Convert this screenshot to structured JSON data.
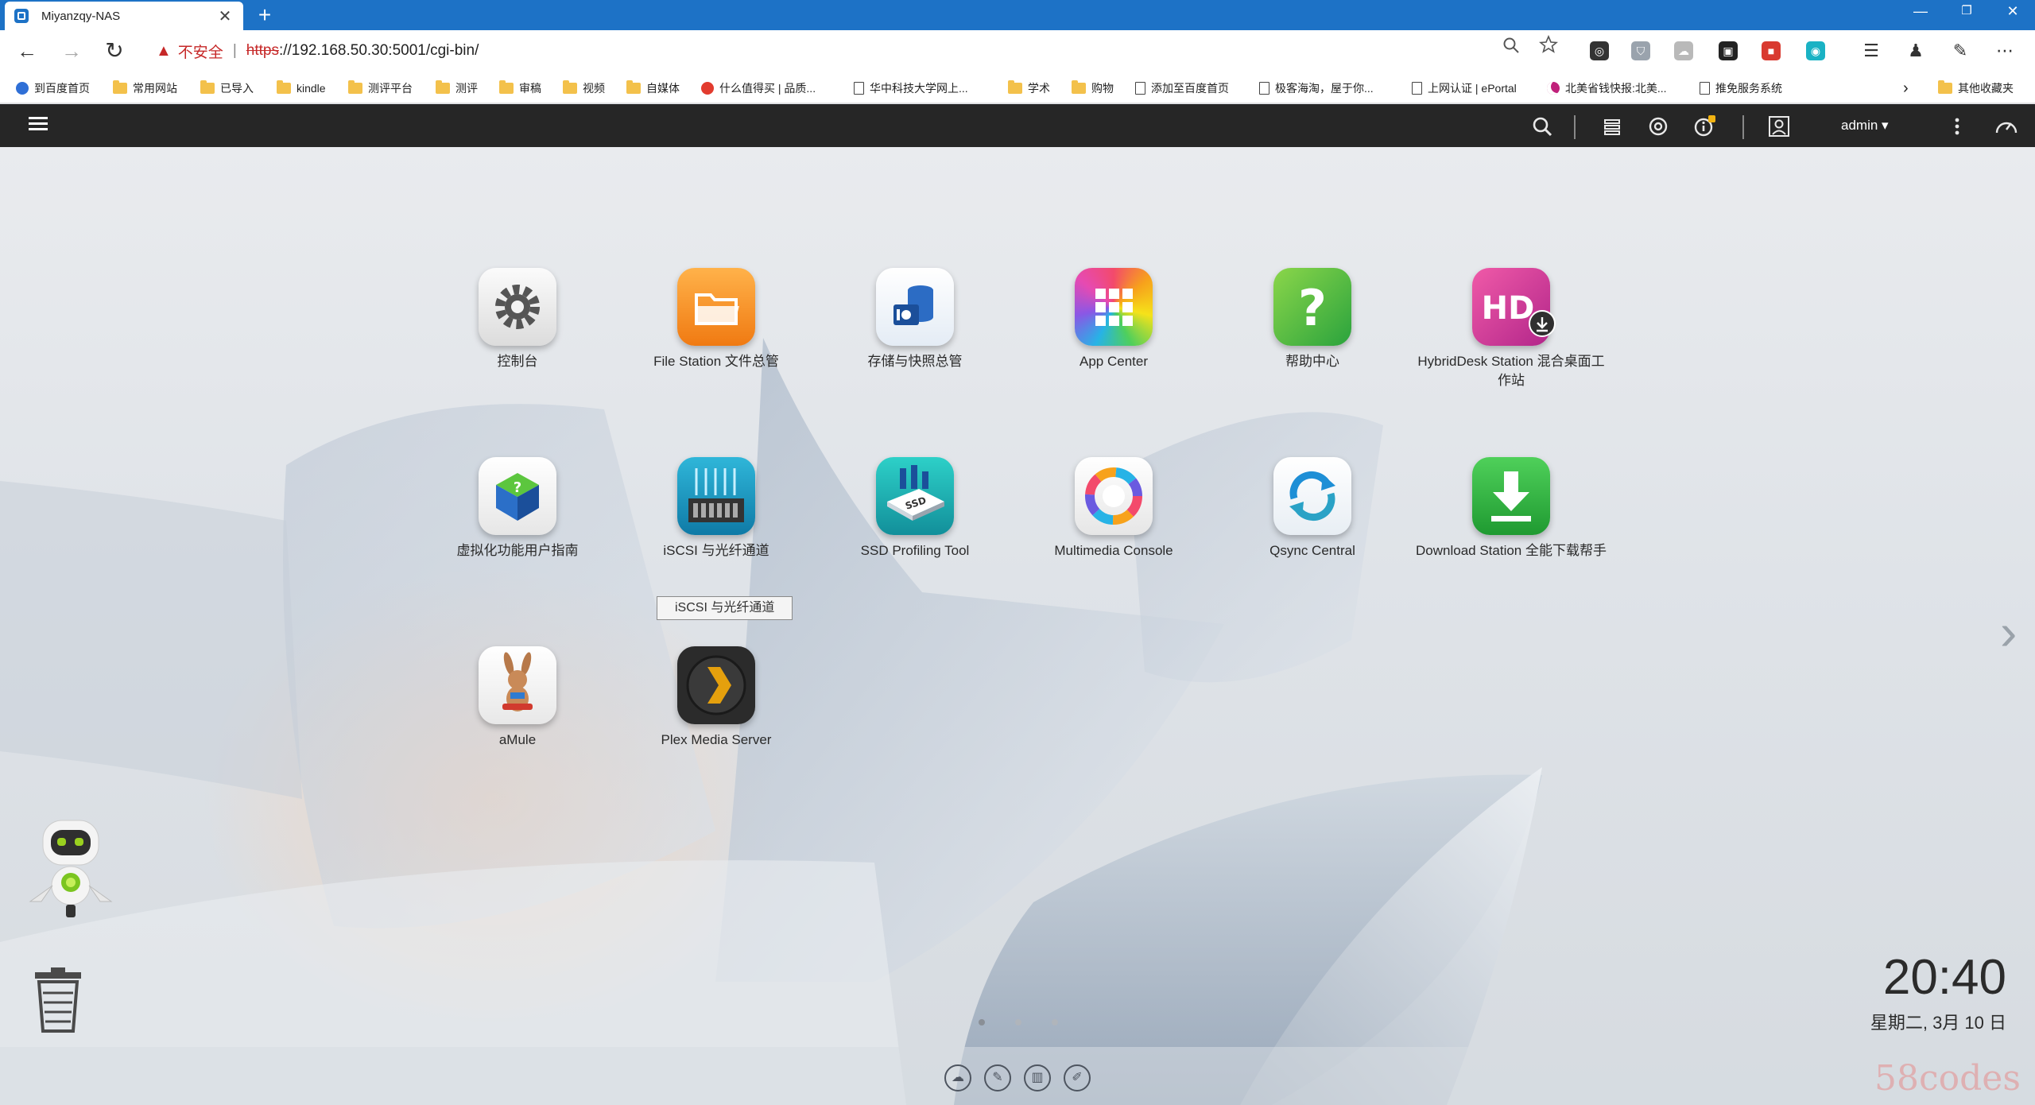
{
  "browser": {
    "tab_title": "Miyanzqy-NAS",
    "tab_close": "✕",
    "new_tab": "+",
    "window": {
      "minimize": "—",
      "maximize": "❐",
      "close": "✕"
    },
    "nav": {
      "back": "←",
      "forward": "→",
      "reload": "↻"
    },
    "address": {
      "security_icon": "▲",
      "security_text": "不安全",
      "separator": "|",
      "url_scheme": "https",
      "url_rest": "://192.168.50.30:5001/cgi-bin/"
    },
    "bookmarks": [
      {
        "label": "到百度首页",
        "icon": "paw"
      },
      {
        "label": "常用网站",
        "icon": "folder"
      },
      {
        "label": "已导入",
        "icon": "folder"
      },
      {
        "label": "kindle",
        "icon": "folder"
      },
      {
        "label": "测评平台",
        "icon": "folder"
      },
      {
        "label": "测评",
        "icon": "folder"
      },
      {
        "label": "审稿",
        "icon": "folder"
      },
      {
        "label": "视频",
        "icon": "folder"
      },
      {
        "label": "自媒体",
        "icon": "folder"
      },
      {
        "label": "什么值得买 | 品质...",
        "icon": "smzdm"
      },
      {
        "label": "华中科技大学网上...",
        "icon": "page"
      },
      {
        "label": "学术",
        "icon": "folder"
      },
      {
        "label": "购物",
        "icon": "folder"
      },
      {
        "label": "添加至百度首页",
        "icon": "page"
      },
      {
        "label": "极客海淘，屋于你...",
        "icon": "page"
      },
      {
        "label": "上网认证 | ePortal",
        "icon": "page"
      },
      {
        "label": "北美省钱快报:北美...",
        "icon": "moon"
      },
      {
        "label": "推免服务系统",
        "icon": "page"
      }
    ],
    "bookmarks_more": "›",
    "other_bookmarks": "其他收藏夹"
  },
  "topbar": {
    "user": "admin ▾"
  },
  "apps": [
    {
      "label": "控制台",
      "icon": "control-panel"
    },
    {
      "label": "File Station 文件总管",
      "icon": "file-station"
    },
    {
      "label": "存储与快照总管",
      "icon": "storage-snapshots"
    },
    {
      "label": "App Center",
      "icon": "app-center"
    },
    {
      "label": "帮助中心",
      "icon": "help-center"
    },
    {
      "label": "HybridDesk Station 混合桌面工作站",
      "icon": "hybriddesk-station"
    },
    {
      "label": "虚拟化功能用户指南",
      "icon": "virtualization-guide"
    },
    {
      "label": "iSCSI 与光纤通道",
      "icon": "iscsi-fc"
    },
    {
      "label": "SSD Profiling Tool",
      "icon": "ssd-profiling"
    },
    {
      "label": "Multimedia Console",
      "icon": "multimedia-console"
    },
    {
      "label": "Qsync Central",
      "icon": "qsync"
    },
    {
      "label": "Download Station 全能下载帮手",
      "icon": "download-station"
    },
    {
      "label": "aMule",
      "icon": "amule"
    },
    {
      "label": "Plex Media Server",
      "icon": "plex"
    }
  ],
  "tooltip": "iSCSI 与光纤通道",
  "clock": {
    "time": "20:40",
    "date": "星期二, 3月 10 日"
  },
  "watermark": "58codes",
  "colors": {
    "topbar": "#262626",
    "browser_accent": "#1d72c6",
    "insecure": "#c62828"
  }
}
